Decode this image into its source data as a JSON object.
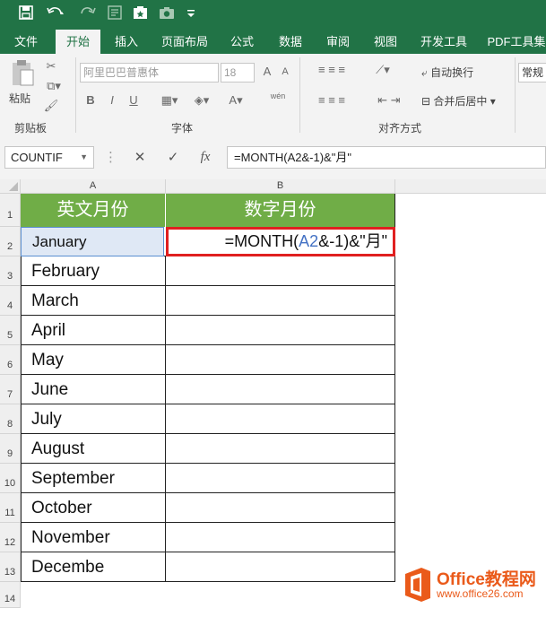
{
  "quick_access": {
    "icons": [
      "save-icon",
      "undo-icon",
      "redo-icon",
      "form-icon",
      "add-icon",
      "camera-icon",
      "customize-icon"
    ]
  },
  "tabs": [
    "文件",
    "开始",
    "插入",
    "页面布局",
    "公式",
    "数据",
    "审阅",
    "视图",
    "开发工具",
    "PDF工具集"
  ],
  "active_tab": "开始",
  "ribbon": {
    "clipboard": {
      "paste_label": "粘贴",
      "group_label": "剪贴板"
    },
    "font": {
      "font_name": "阿里巴巴普惠体",
      "font_size": "18",
      "group_label": "字体",
      "bold": "B",
      "italic": "I",
      "underline": "U",
      "grow": "A",
      "shrink": "A",
      "font_color": "A",
      "phonetic": "wén"
    },
    "alignment": {
      "wrap_label": "自动换行",
      "merge_label": "合并后居中",
      "group_label": "对齐方式"
    },
    "number": {
      "format": "常规"
    }
  },
  "formula_bar": {
    "name_box": "COUNTIF",
    "cancel": "✕",
    "enter": "✓",
    "fx": "fx",
    "formula": "=MONTH(A2&-1)&\"月\""
  },
  "sheet": {
    "columns": [
      "A",
      "B"
    ],
    "rows": [
      "1",
      "2",
      "3",
      "4",
      "5",
      "6",
      "7",
      "8",
      "9",
      "10",
      "11",
      "12",
      "13",
      "14"
    ],
    "header": {
      "a": "英文月份",
      "b": "数字月份"
    },
    "months": [
      "January",
      "February",
      "March",
      "April",
      "May",
      "June",
      "July",
      "August",
      "September",
      "October",
      "November",
      "Decembe"
    ],
    "formula_display": {
      "prefix": "=MONTH(",
      "ref": "A2",
      "suffix": "&-1)&\"月\""
    }
  },
  "watermark": {
    "brand": "Office教程网",
    "url": "www.office26.com"
  },
  "colors": {
    "excel_green": "#217346",
    "header_green": "#70ad47",
    "highlight_red": "#e02020",
    "ref_blue": "#4472c4"
  }
}
